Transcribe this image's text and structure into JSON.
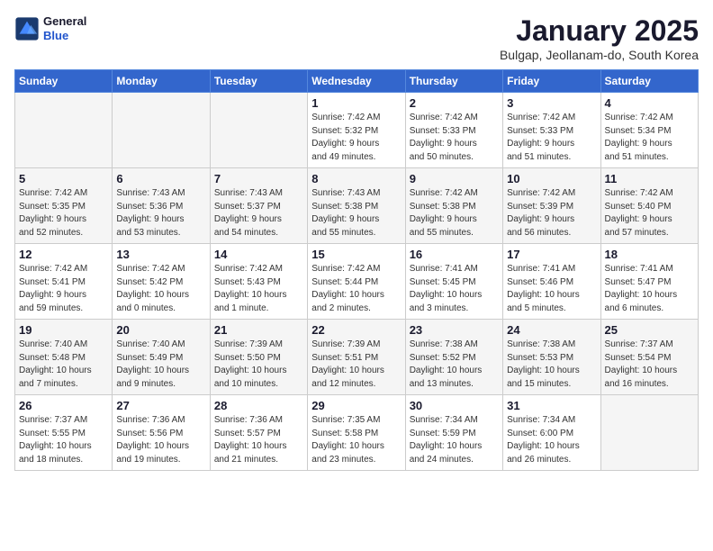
{
  "logo": {
    "general": "General",
    "blue": "Blue"
  },
  "header": {
    "month": "January 2025",
    "location": "Bulgap, Jeollanam-do, South Korea"
  },
  "weekdays": [
    "Sunday",
    "Monday",
    "Tuesday",
    "Wednesday",
    "Thursday",
    "Friday",
    "Saturday"
  ],
  "weeks": [
    [
      {
        "day": "",
        "info": ""
      },
      {
        "day": "",
        "info": ""
      },
      {
        "day": "",
        "info": ""
      },
      {
        "day": "1",
        "info": "Sunrise: 7:42 AM\nSunset: 5:32 PM\nDaylight: 9 hours\nand 49 minutes."
      },
      {
        "day": "2",
        "info": "Sunrise: 7:42 AM\nSunset: 5:33 PM\nDaylight: 9 hours\nand 50 minutes."
      },
      {
        "day": "3",
        "info": "Sunrise: 7:42 AM\nSunset: 5:33 PM\nDaylight: 9 hours\nand 51 minutes."
      },
      {
        "day": "4",
        "info": "Sunrise: 7:42 AM\nSunset: 5:34 PM\nDaylight: 9 hours\nand 51 minutes."
      }
    ],
    [
      {
        "day": "5",
        "info": "Sunrise: 7:42 AM\nSunset: 5:35 PM\nDaylight: 9 hours\nand 52 minutes."
      },
      {
        "day": "6",
        "info": "Sunrise: 7:43 AM\nSunset: 5:36 PM\nDaylight: 9 hours\nand 53 minutes."
      },
      {
        "day": "7",
        "info": "Sunrise: 7:43 AM\nSunset: 5:37 PM\nDaylight: 9 hours\nand 54 minutes."
      },
      {
        "day": "8",
        "info": "Sunrise: 7:43 AM\nSunset: 5:38 PM\nDaylight: 9 hours\nand 55 minutes."
      },
      {
        "day": "9",
        "info": "Sunrise: 7:42 AM\nSunset: 5:38 PM\nDaylight: 9 hours\nand 55 minutes."
      },
      {
        "day": "10",
        "info": "Sunrise: 7:42 AM\nSunset: 5:39 PM\nDaylight: 9 hours\nand 56 minutes."
      },
      {
        "day": "11",
        "info": "Sunrise: 7:42 AM\nSunset: 5:40 PM\nDaylight: 9 hours\nand 57 minutes."
      }
    ],
    [
      {
        "day": "12",
        "info": "Sunrise: 7:42 AM\nSunset: 5:41 PM\nDaylight: 9 hours\nand 59 minutes."
      },
      {
        "day": "13",
        "info": "Sunrise: 7:42 AM\nSunset: 5:42 PM\nDaylight: 10 hours\nand 0 minutes."
      },
      {
        "day": "14",
        "info": "Sunrise: 7:42 AM\nSunset: 5:43 PM\nDaylight: 10 hours\nand 1 minute."
      },
      {
        "day": "15",
        "info": "Sunrise: 7:42 AM\nSunset: 5:44 PM\nDaylight: 10 hours\nand 2 minutes."
      },
      {
        "day": "16",
        "info": "Sunrise: 7:41 AM\nSunset: 5:45 PM\nDaylight: 10 hours\nand 3 minutes."
      },
      {
        "day": "17",
        "info": "Sunrise: 7:41 AM\nSunset: 5:46 PM\nDaylight: 10 hours\nand 5 minutes."
      },
      {
        "day": "18",
        "info": "Sunrise: 7:41 AM\nSunset: 5:47 PM\nDaylight: 10 hours\nand 6 minutes."
      }
    ],
    [
      {
        "day": "19",
        "info": "Sunrise: 7:40 AM\nSunset: 5:48 PM\nDaylight: 10 hours\nand 7 minutes."
      },
      {
        "day": "20",
        "info": "Sunrise: 7:40 AM\nSunset: 5:49 PM\nDaylight: 10 hours\nand 9 minutes."
      },
      {
        "day": "21",
        "info": "Sunrise: 7:39 AM\nSunset: 5:50 PM\nDaylight: 10 hours\nand 10 minutes."
      },
      {
        "day": "22",
        "info": "Sunrise: 7:39 AM\nSunset: 5:51 PM\nDaylight: 10 hours\nand 12 minutes."
      },
      {
        "day": "23",
        "info": "Sunrise: 7:38 AM\nSunset: 5:52 PM\nDaylight: 10 hours\nand 13 minutes."
      },
      {
        "day": "24",
        "info": "Sunrise: 7:38 AM\nSunset: 5:53 PM\nDaylight: 10 hours\nand 15 minutes."
      },
      {
        "day": "25",
        "info": "Sunrise: 7:37 AM\nSunset: 5:54 PM\nDaylight: 10 hours\nand 16 minutes."
      }
    ],
    [
      {
        "day": "26",
        "info": "Sunrise: 7:37 AM\nSunset: 5:55 PM\nDaylight: 10 hours\nand 18 minutes."
      },
      {
        "day": "27",
        "info": "Sunrise: 7:36 AM\nSunset: 5:56 PM\nDaylight: 10 hours\nand 19 minutes."
      },
      {
        "day": "28",
        "info": "Sunrise: 7:36 AM\nSunset: 5:57 PM\nDaylight: 10 hours\nand 21 minutes."
      },
      {
        "day": "29",
        "info": "Sunrise: 7:35 AM\nSunset: 5:58 PM\nDaylight: 10 hours\nand 23 minutes."
      },
      {
        "day": "30",
        "info": "Sunrise: 7:34 AM\nSunset: 5:59 PM\nDaylight: 10 hours\nand 24 minutes."
      },
      {
        "day": "31",
        "info": "Sunrise: 7:34 AM\nSunset: 6:00 PM\nDaylight: 10 hours\nand 26 minutes."
      },
      {
        "day": "",
        "info": ""
      }
    ]
  ]
}
